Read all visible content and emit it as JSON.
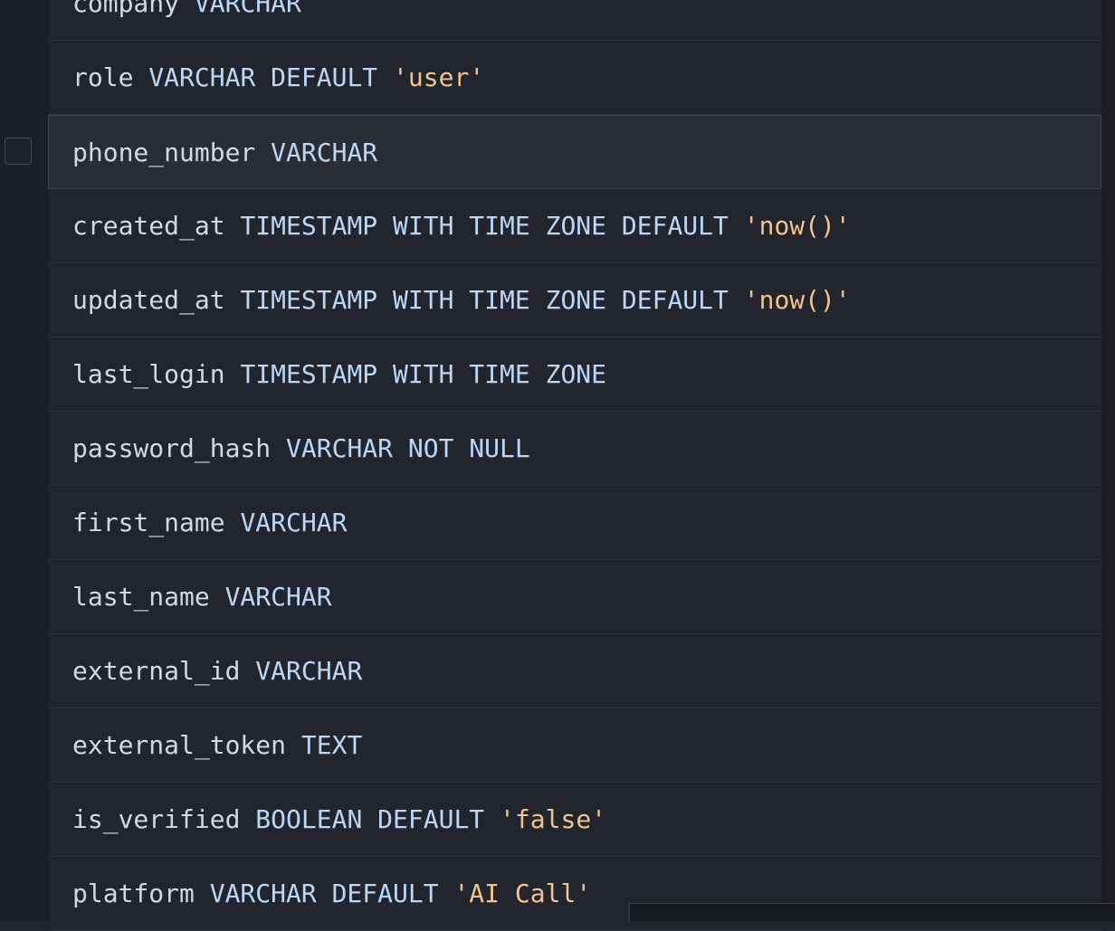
{
  "columns": [
    {
      "name": "company",
      "type": "VARCHAR",
      "default": ""
    },
    {
      "name": "role",
      "type": "VARCHAR DEFAULT",
      "default": "'user'"
    },
    {
      "name": "phone_number",
      "type": "VARCHAR",
      "default": ""
    },
    {
      "name": "created_at",
      "type": "TIMESTAMP WITH TIME ZONE DEFAULT",
      "default": "'now()'"
    },
    {
      "name": "updated_at",
      "type": "TIMESTAMP WITH TIME ZONE DEFAULT",
      "default": "'now()'"
    },
    {
      "name": "last_login",
      "type": "TIMESTAMP WITH TIME ZONE",
      "default": ""
    },
    {
      "name": "password_hash",
      "type": "VARCHAR NOT NULL",
      "default": ""
    },
    {
      "name": "first_name",
      "type": "VARCHAR",
      "default": ""
    },
    {
      "name": "last_name",
      "type": "VARCHAR",
      "default": ""
    },
    {
      "name": "external_id",
      "type": "VARCHAR",
      "default": ""
    },
    {
      "name": "external_token",
      "type": "TEXT",
      "default": ""
    },
    {
      "name": "is_verified",
      "type": "BOOLEAN DEFAULT",
      "default": "'false'"
    },
    {
      "name": "platform",
      "type": "VARCHAR DEFAULT",
      "default": "'AI Call'"
    }
  ],
  "selected_index": 2,
  "colors": {
    "background": "#22252d",
    "column_name": "#d6d8de",
    "type_keyword": "#bcd6f6",
    "string_literal": "#f3c38e"
  }
}
